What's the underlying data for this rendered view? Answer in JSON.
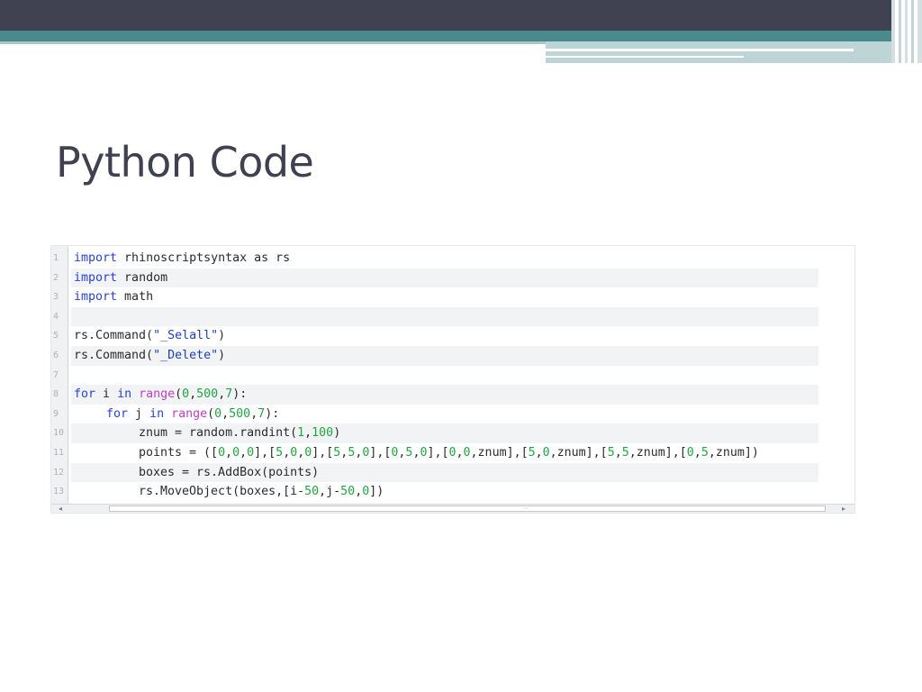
{
  "slide": {
    "title": "Python Code"
  },
  "editor": {
    "lines": [
      {
        "no": "1",
        "indent": 0,
        "tokens": [
          {
            "t": "import",
            "c": "kw"
          },
          {
            "t": " rhinoscriptsyntax as rs",
            "c": ""
          }
        ]
      },
      {
        "no": "2",
        "indent": 0,
        "tokens": [
          {
            "t": "import",
            "c": "kw"
          },
          {
            "t": " random",
            "c": ""
          }
        ]
      },
      {
        "no": "3",
        "indent": 0,
        "tokens": [
          {
            "t": "import",
            "c": "kw"
          },
          {
            "t": " math",
            "c": ""
          }
        ]
      },
      {
        "no": "4",
        "indent": 0,
        "tokens": []
      },
      {
        "no": "5",
        "indent": 0,
        "tokens": [
          {
            "t": "rs.Command(",
            "c": ""
          },
          {
            "t": "\"_Selall\"",
            "c": "str"
          },
          {
            "t": ")",
            "c": ""
          }
        ]
      },
      {
        "no": "6",
        "indent": 0,
        "tokens": [
          {
            "t": "rs.Command(",
            "c": ""
          },
          {
            "t": "\"_Delete\"",
            "c": "str"
          },
          {
            "t": ")",
            "c": ""
          }
        ]
      },
      {
        "no": "7",
        "indent": 0,
        "tokens": []
      },
      {
        "no": "8",
        "indent": 0,
        "tokens": [
          {
            "t": "for",
            "c": "kw"
          },
          {
            "t": " i ",
            "c": ""
          },
          {
            "t": "in",
            "c": "kw"
          },
          {
            "t": " ",
            "c": ""
          },
          {
            "t": "range",
            "c": "fn"
          },
          {
            "t": "(",
            "c": ""
          },
          {
            "t": "0",
            "c": "num"
          },
          {
            "t": ",",
            "c": ""
          },
          {
            "t": "500",
            "c": "num"
          },
          {
            "t": ",",
            "c": ""
          },
          {
            "t": "7",
            "c": "num"
          },
          {
            "t": "):",
            "c": ""
          }
        ]
      },
      {
        "no": "9",
        "indent": 1,
        "tokens": [
          {
            "t": "for",
            "c": "kw"
          },
          {
            "t": " j ",
            "c": ""
          },
          {
            "t": "in",
            "c": "kw"
          },
          {
            "t": " ",
            "c": ""
          },
          {
            "t": "range",
            "c": "fn"
          },
          {
            "t": "(",
            "c": ""
          },
          {
            "t": "0",
            "c": "num"
          },
          {
            "t": ",",
            "c": ""
          },
          {
            "t": "500",
            "c": "num"
          },
          {
            "t": ",",
            "c": ""
          },
          {
            "t": "7",
            "c": "num"
          },
          {
            "t": "):",
            "c": ""
          }
        ]
      },
      {
        "no": "10",
        "indent": 2,
        "tokens": [
          {
            "t": "znum = random.randint(",
            "c": ""
          },
          {
            "t": "1",
            "c": "num"
          },
          {
            "t": ",",
            "c": ""
          },
          {
            "t": "100",
            "c": "num"
          },
          {
            "t": ")",
            "c": ""
          }
        ]
      },
      {
        "no": "11",
        "indent": 2,
        "tokens": [
          {
            "t": "points = ([",
            "c": ""
          },
          {
            "t": "0",
            "c": "num"
          },
          {
            "t": ",",
            "c": ""
          },
          {
            "t": "0",
            "c": "num"
          },
          {
            "t": ",",
            "c": ""
          },
          {
            "t": "0",
            "c": "num"
          },
          {
            "t": "],[",
            "c": ""
          },
          {
            "t": "5",
            "c": "num"
          },
          {
            "t": ",",
            "c": ""
          },
          {
            "t": "0",
            "c": "num"
          },
          {
            "t": ",",
            "c": ""
          },
          {
            "t": "0",
            "c": "num"
          },
          {
            "t": "],[",
            "c": ""
          },
          {
            "t": "5",
            "c": "num"
          },
          {
            "t": ",",
            "c": ""
          },
          {
            "t": "5",
            "c": "num"
          },
          {
            "t": ",",
            "c": ""
          },
          {
            "t": "0",
            "c": "num"
          },
          {
            "t": "],[",
            "c": ""
          },
          {
            "t": "0",
            "c": "num"
          },
          {
            "t": ",",
            "c": ""
          },
          {
            "t": "5",
            "c": "num"
          },
          {
            "t": ",",
            "c": ""
          },
          {
            "t": "0",
            "c": "num"
          },
          {
            "t": "],[",
            "c": ""
          },
          {
            "t": "0",
            "c": "num"
          },
          {
            "t": ",",
            "c": ""
          },
          {
            "t": "0",
            "c": "num"
          },
          {
            "t": ",znum],[",
            "c": ""
          },
          {
            "t": "5",
            "c": "num"
          },
          {
            "t": ",",
            "c": ""
          },
          {
            "t": "0",
            "c": "num"
          },
          {
            "t": ",znum],[",
            "c": ""
          },
          {
            "t": "5",
            "c": "num"
          },
          {
            "t": ",",
            "c": ""
          },
          {
            "t": "5",
            "c": "num"
          },
          {
            "t": ",znum],[",
            "c": ""
          },
          {
            "t": "0",
            "c": "num"
          },
          {
            "t": ",",
            "c": ""
          },
          {
            "t": "5",
            "c": "num"
          },
          {
            "t": ",znum])",
            "c": ""
          }
        ]
      },
      {
        "no": "12",
        "indent": 2,
        "tokens": [
          {
            "t": "boxes = rs.AddBox(points)",
            "c": ""
          }
        ]
      },
      {
        "no": "13",
        "indent": 2,
        "tokens": [
          {
            "t": "rs.MoveObject(boxes,[i-",
            "c": ""
          },
          {
            "t": "50",
            "c": "num"
          },
          {
            "t": ",j-",
            "c": ""
          },
          {
            "t": "50",
            "c": "num"
          },
          {
            "t": ",",
            "c": ""
          },
          {
            "t": "0",
            "c": "num"
          },
          {
            "t": "])",
            "c": ""
          }
        ]
      }
    ],
    "scrollbar": {
      "left_arrow": "◂",
      "grip": "⋯",
      "right_arrow": "▸"
    }
  },
  "colors": {
    "keyword": "#2a40d8",
    "builtin": "#c23ec2",
    "string": "#1f3fb5",
    "number": "#20a640",
    "title": "#3f4150",
    "header_band": "#404252",
    "teal_band": "#4b8a8c"
  }
}
